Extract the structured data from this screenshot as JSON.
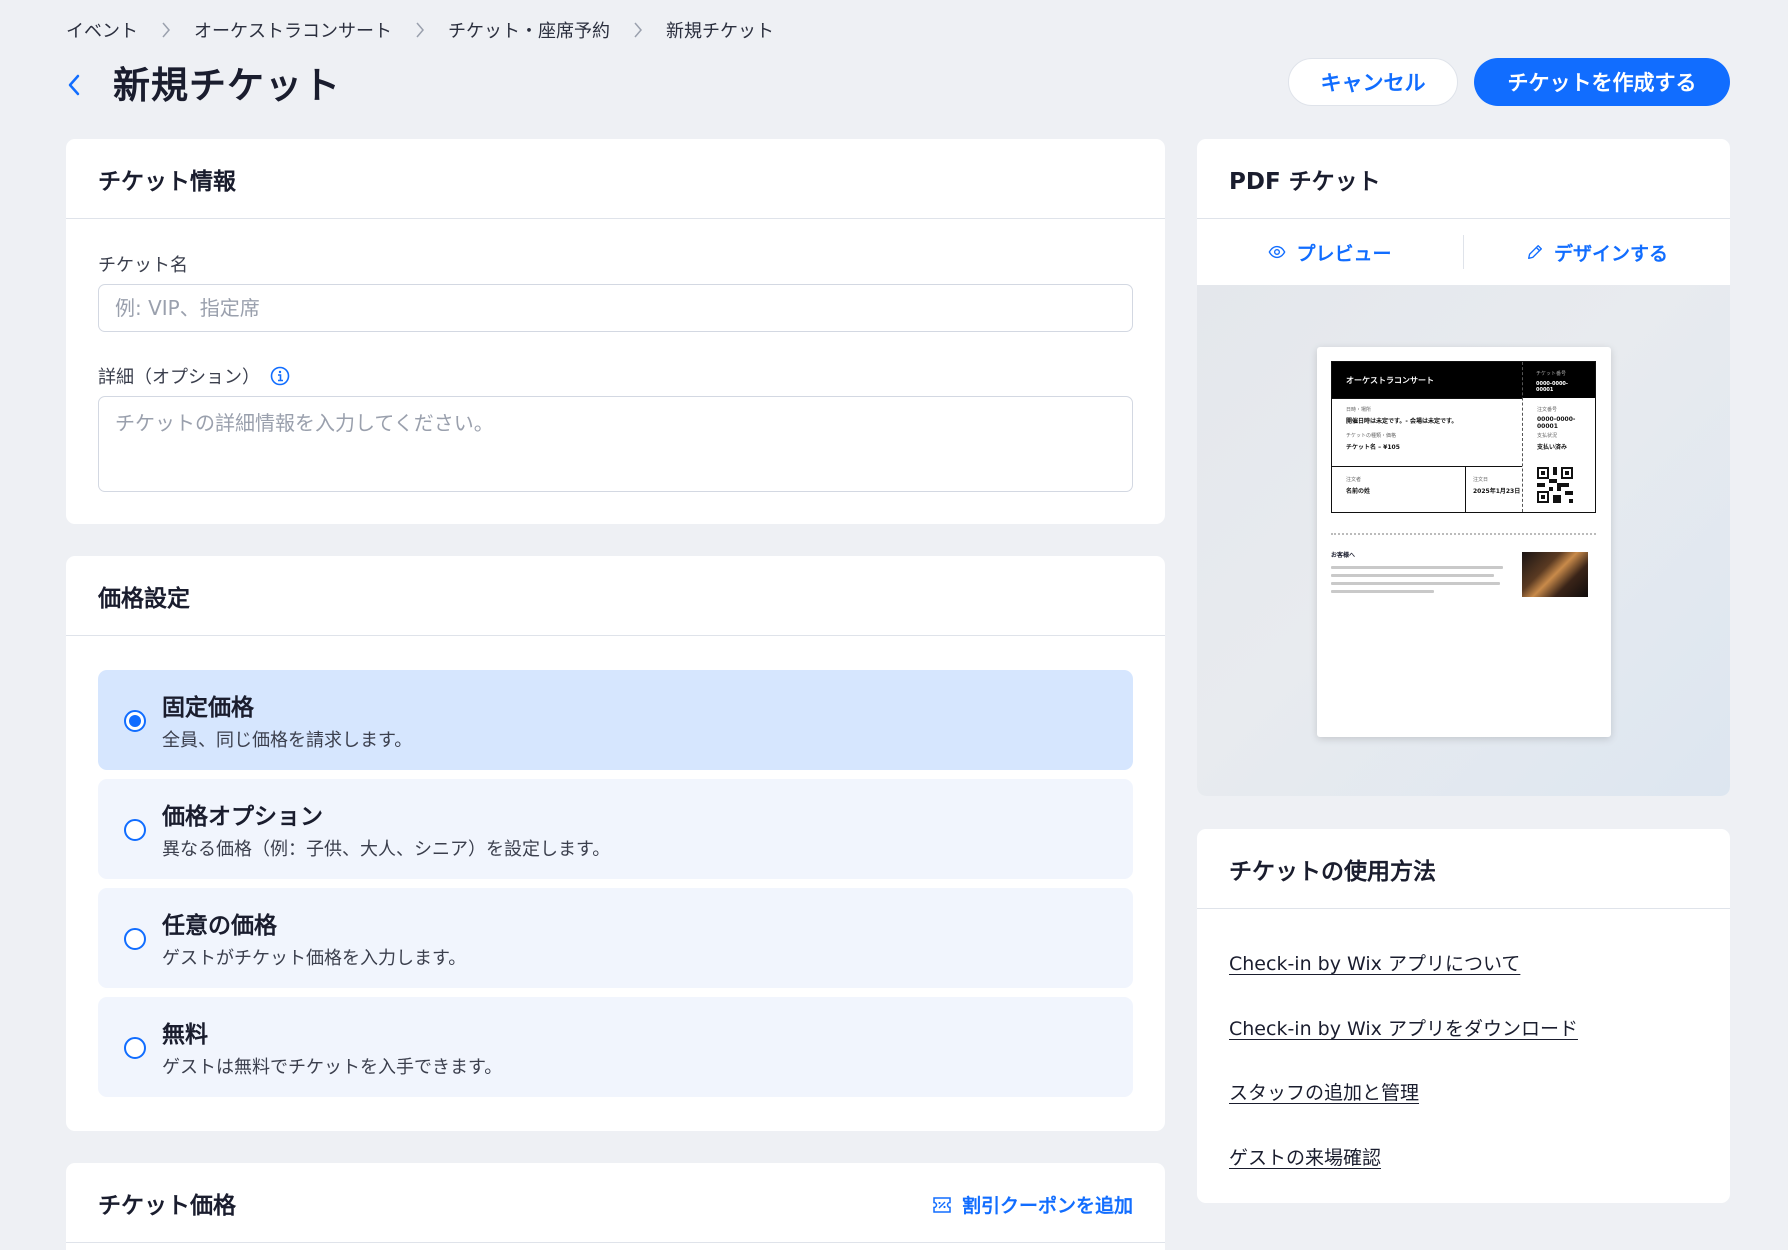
{
  "breadcrumb": [
    "イベント",
    "オーケストラコンサート",
    "チケット・座席予約",
    "新規チケット"
  ],
  "page_title": "新規チケット",
  "actions": {
    "cancel": "キャンセル",
    "create": "チケットを作成する"
  },
  "ticket_info": {
    "title": "チケット情報",
    "name_label": "チケット名",
    "name_placeholder": "例: VIP、指定席",
    "details_label": "詳細（オプション）",
    "details_placeholder": "チケットの詳細情報を入力してください。"
  },
  "pricing": {
    "title": "価格設定",
    "options": [
      {
        "title": "固定価格",
        "desc": "全員、同じ価格を請求します。",
        "selected": true
      },
      {
        "title": "価格オプション",
        "desc": "異なる価格（例：子供、大人、シニア）を設定します。",
        "selected": false
      },
      {
        "title": "任意の価格",
        "desc": "ゲストがチケット価格を入力します。",
        "selected": false
      },
      {
        "title": "無料",
        "desc": "ゲストは無料でチケットを入手できます。",
        "selected": false
      }
    ]
  },
  "ticket_price": {
    "title": "チケット価格",
    "coupon": "割引クーポンを追加"
  },
  "pdf": {
    "title": "PDF チケット",
    "preview": "プレビュー",
    "design": "デザインする",
    "sample": {
      "event": "オーケストラコンサート",
      "ticket_no_label": "チケット番号",
      "ticket_no": "0000-0000-00001",
      "datetime_label": "日時・場所",
      "datetime_value": "開催日時は未定です。- 会場は未定です。",
      "type_label": "チケットの種類・価格",
      "type_value": "チケット名 – ¥105",
      "order_no_label": "注文番号",
      "order_no": "0000-0000-00001",
      "payment_label": "支払状況",
      "payment_value": "支払い済み",
      "buyer_label": "注文者",
      "buyer_value": "名前の姓",
      "order_date_label": "注文日",
      "order_date": "2025年1月23日",
      "note_title": "お客様へ"
    }
  },
  "usage": {
    "title": "チケットの使用方法",
    "links": [
      "Check-in by Wix アプリについて",
      "Check-in by Wix アプリをダウンロード",
      "スタッフの追加と管理",
      "ゲストの来場確認"
    ]
  },
  "colors": {
    "accent": "#116dff",
    "selected_bg": "#d6e6fe",
    "option_bg": "#f1f5fd",
    "page_bg": "#eef0f4"
  }
}
